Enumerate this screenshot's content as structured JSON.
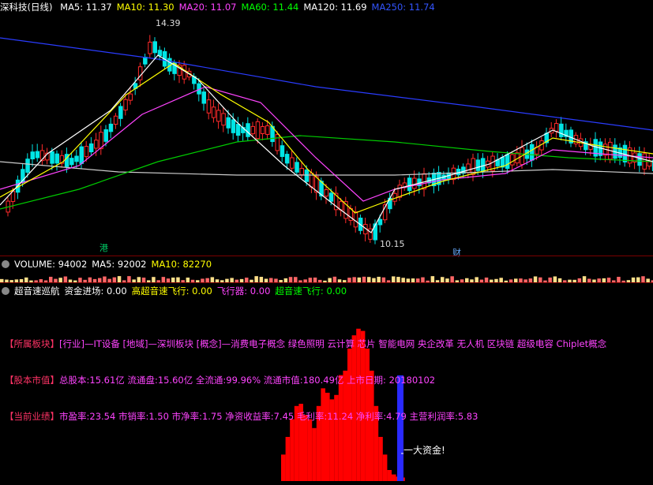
{
  "price_panel": {
    "title": "深科技(日线)",
    "ma_labels": [
      {
        "text": "MA5: 11.37",
        "color": "#ffffff"
      },
      {
        "text": "MA10: 11.30",
        "color": "#ffff00"
      },
      {
        "text": "MA20: 11.07",
        "color": "#ff44ff"
      },
      {
        "text": "MA60: 11.44",
        "color": "#00ff00"
      },
      {
        "text": "MA120: 11.69",
        "color": "#ffffff"
      },
      {
        "text": "MA250: 11.74",
        "color": "#3355ff"
      }
    ],
    "high_label": "14.39",
    "low_label": "10.15",
    "marker_gang": "港",
    "marker_cai": "财",
    "up_color": "#ff2a2a",
    "down_color": "#00e5e5"
  },
  "volume_panel": {
    "labels": [
      {
        "text": "VOLUME: 94002",
        "color": "#ffffff"
      },
      {
        "text": "MA5: 92002",
        "color": "#ffffff"
      },
      {
        "text": "MA10: 82270",
        "color": "#ffff00"
      }
    ]
  },
  "indicator_panel": {
    "labels": [
      {
        "text": "超音速巡航",
        "color": "#ffffff"
      },
      {
        "text": "资金进场: 0.00",
        "color": "#ffffff"
      },
      {
        "text": "高超音速飞行: 0.00",
        "color": "#ffff00"
      },
      {
        "text": "飞行器: 0.00",
        "color": "#ff44ff"
      },
      {
        "text": "超音速飞行: 0.00",
        "color": "#00ff00"
      }
    ],
    "line1_key": "【所属板块】",
    "line1_val": "[行业]—IT设备 [地域]—深圳板块 [概念]—消费电子概念 绿色照明 云计算 芯片 智能电网 央企改革 无人机 区块链 超级电容 Chiplet概念",
    "line2_key": "【股本市值】",
    "line2_val": "总股本:15.61亿 流通盘:15.60亿 全流通:99.96% 流通市值:180.49亿 上市日期: 20180102",
    "line3_key": "【当前业绩】",
    "line3_val": "市盈率:23.54 市销率:1.50 市净率:1.75 净资收益率:7.45 毛利率:11.24 净利率:4.79 主营利润率:5.83",
    "big_money_label": "一大资金!",
    "bar_color": "#ff0000",
    "signal_color": "#2a2aff"
  }
}
